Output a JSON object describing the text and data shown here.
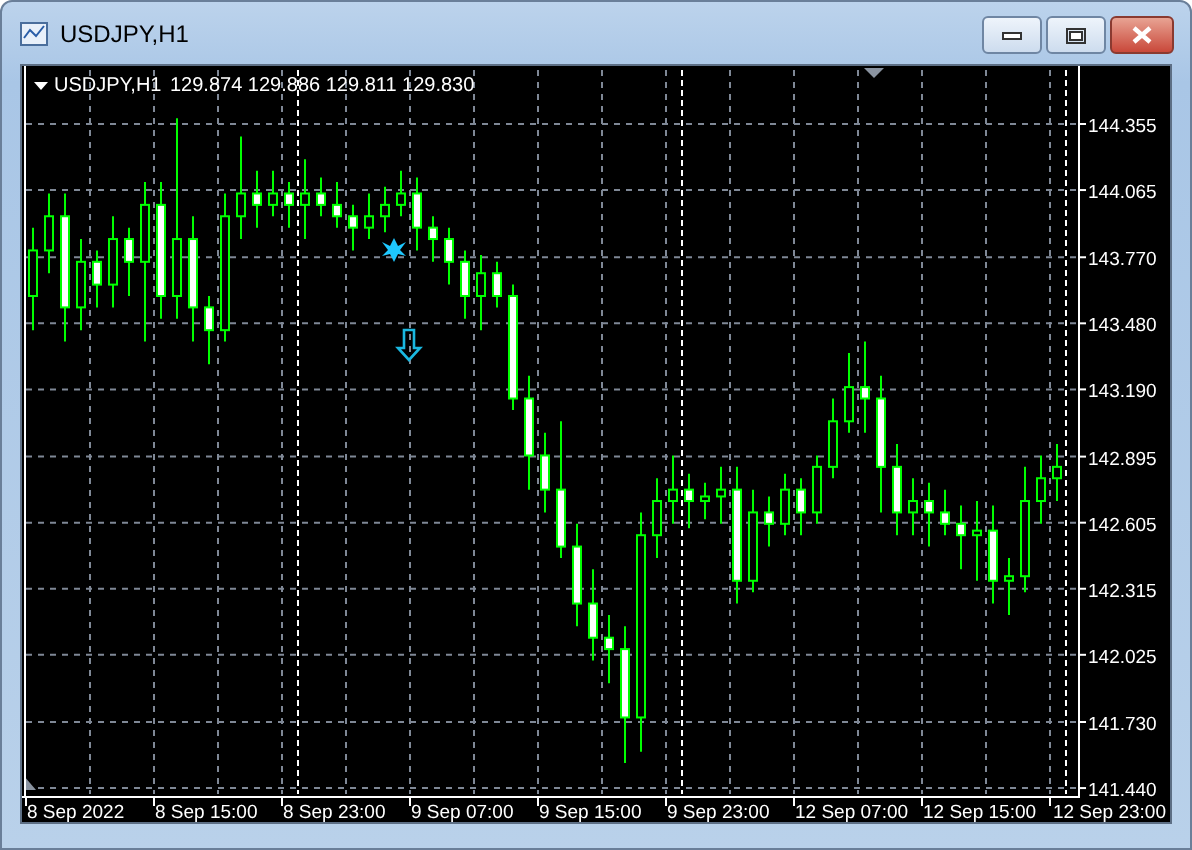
{
  "window": {
    "title": "USDJPY,H1"
  },
  "chart": {
    "symbol": "USDJPY,H1",
    "quote": "129.874 129.886 129.811 129.830",
    "chart_data": {
      "type": "candlestick",
      "ylim": [
        141.414,
        144.592
      ],
      "yticks": [
        {
          "value": 144.355,
          "label": "144.355"
        },
        {
          "value": 144.065,
          "label": "144.065"
        },
        {
          "value": 143.77,
          "label": "143.770"
        },
        {
          "value": 143.48,
          "label": "143.480"
        },
        {
          "value": 143.19,
          "label": "143.190"
        },
        {
          "value": 142.895,
          "label": "142.895"
        },
        {
          "value": 142.605,
          "label": "142.605"
        },
        {
          "value": 142.315,
          "label": "142.315"
        },
        {
          "value": 142.025,
          "label": "142.025"
        },
        {
          "value": 141.73,
          "label": "141.730"
        },
        {
          "value": 141.44,
          "label": "141.440"
        }
      ],
      "grid": true,
      "ohlc": [
        [
          143.6,
          143.9,
          143.45,
          143.8
        ],
        [
          143.8,
          144.05,
          143.7,
          143.95
        ],
        [
          143.95,
          144.05,
          143.4,
          143.55
        ],
        [
          143.55,
          143.85,
          143.45,
          143.75
        ],
        [
          143.75,
          143.8,
          143.55,
          143.65
        ],
        [
          143.65,
          143.95,
          143.55,
          143.85
        ],
        [
          143.85,
          143.9,
          143.6,
          143.75
        ],
        [
          143.75,
          144.1,
          143.4,
          144.0
        ],
        [
          144.0,
          144.1,
          143.5,
          143.6
        ],
        [
          143.6,
          144.38,
          143.5,
          143.85
        ],
        [
          143.85,
          143.95,
          143.4,
          143.55
        ],
        [
          143.55,
          143.6,
          143.3,
          143.45
        ],
        [
          143.45,
          144.05,
          143.4,
          143.95
        ],
        [
          143.95,
          144.3,
          143.85,
          144.05
        ],
        [
          144.05,
          144.15,
          143.9,
          144.0
        ],
        [
          144.0,
          144.15,
          143.95,
          144.05
        ],
        [
          144.05,
          144.1,
          143.9,
          144.0
        ],
        [
          144.0,
          144.2,
          143.85,
          144.05
        ],
        [
          144.05,
          144.12,
          143.95,
          144.0
        ],
        [
          144.0,
          144.1,
          143.9,
          143.95
        ],
        [
          143.95,
          144.0,
          143.8,
          143.9
        ],
        [
          143.9,
          144.05,
          143.85,
          143.95
        ],
        [
          143.95,
          144.08,
          143.88,
          144.0
        ],
        [
          144.0,
          144.15,
          143.95,
          144.05
        ],
        [
          144.05,
          144.12,
          143.8,
          143.9
        ],
        [
          143.9,
          143.95,
          143.75,
          143.85
        ],
        [
          143.85,
          143.9,
          143.65,
          143.75
        ],
        [
          143.75,
          143.8,
          143.5,
          143.6
        ],
        [
          143.6,
          143.78,
          143.45,
          143.7
        ],
        [
          143.7,
          143.75,
          143.55,
          143.6
        ],
        [
          143.6,
          143.65,
          143.1,
          143.15
        ],
        [
          143.15,
          143.25,
          142.75,
          142.9
        ],
        [
          142.9,
          143.0,
          142.65,
          142.75
        ],
        [
          142.75,
          143.05,
          142.45,
          142.5
        ],
        [
          142.5,
          142.6,
          142.15,
          142.25
        ],
        [
          142.25,
          142.4,
          142.0,
          142.1
        ],
        [
          142.1,
          142.2,
          141.9,
          142.05
        ],
        [
          142.05,
          142.15,
          141.55,
          141.75
        ],
        [
          141.75,
          142.65,
          141.6,
          142.55
        ],
        [
          142.55,
          142.8,
          142.45,
          142.7
        ],
        [
          142.7,
          142.9,
          142.6,
          142.75
        ],
        [
          142.75,
          142.82,
          142.58,
          142.7
        ],
        [
          142.7,
          142.78,
          142.62,
          142.72
        ],
        [
          142.72,
          142.85,
          142.6,
          142.75
        ],
        [
          142.75,
          142.85,
          142.25,
          142.35
        ],
        [
          142.35,
          142.75,
          142.3,
          142.65
        ],
        [
          142.65,
          142.72,
          142.5,
          142.6
        ],
        [
          142.6,
          142.82,
          142.55,
          142.75
        ],
        [
          142.75,
          142.8,
          142.55,
          142.65
        ],
        [
          142.65,
          142.9,
          142.6,
          142.85
        ],
        [
          142.85,
          143.15,
          142.8,
          143.05
        ],
        [
          143.05,
          143.35,
          143.0,
          143.2
        ],
        [
          143.2,
          143.4,
          143.0,
          143.15
        ],
        [
          143.15,
          143.25,
          142.65,
          142.85
        ],
        [
          142.85,
          142.95,
          142.55,
          142.65
        ],
        [
          142.65,
          142.8,
          142.55,
          142.7
        ],
        [
          142.7,
          142.78,
          142.5,
          142.65
        ],
        [
          142.65,
          142.75,
          142.55,
          142.6
        ],
        [
          142.6,
          142.68,
          142.4,
          142.55
        ],
        [
          142.55,
          142.7,
          142.35,
          142.57
        ],
        [
          142.57,
          142.68,
          142.25,
          142.35
        ],
        [
          142.35,
          142.45,
          142.2,
          142.37
        ],
        [
          142.37,
          142.85,
          142.3,
          142.7
        ],
        [
          142.7,
          142.9,
          142.6,
          142.8
        ],
        [
          142.8,
          142.95,
          142.7,
          142.85
        ]
      ]
    },
    "time_labels": [
      "8 Sep 2022",
      "8 Sep 15:00",
      "8 Sep 23:00",
      "9 Sep 07:00",
      "9 Sep 15:00",
      "9 Sep 23:00",
      "12 Sep 07:00",
      "12 Sep 15:00",
      "12 Sep 23:00"
    ]
  }
}
